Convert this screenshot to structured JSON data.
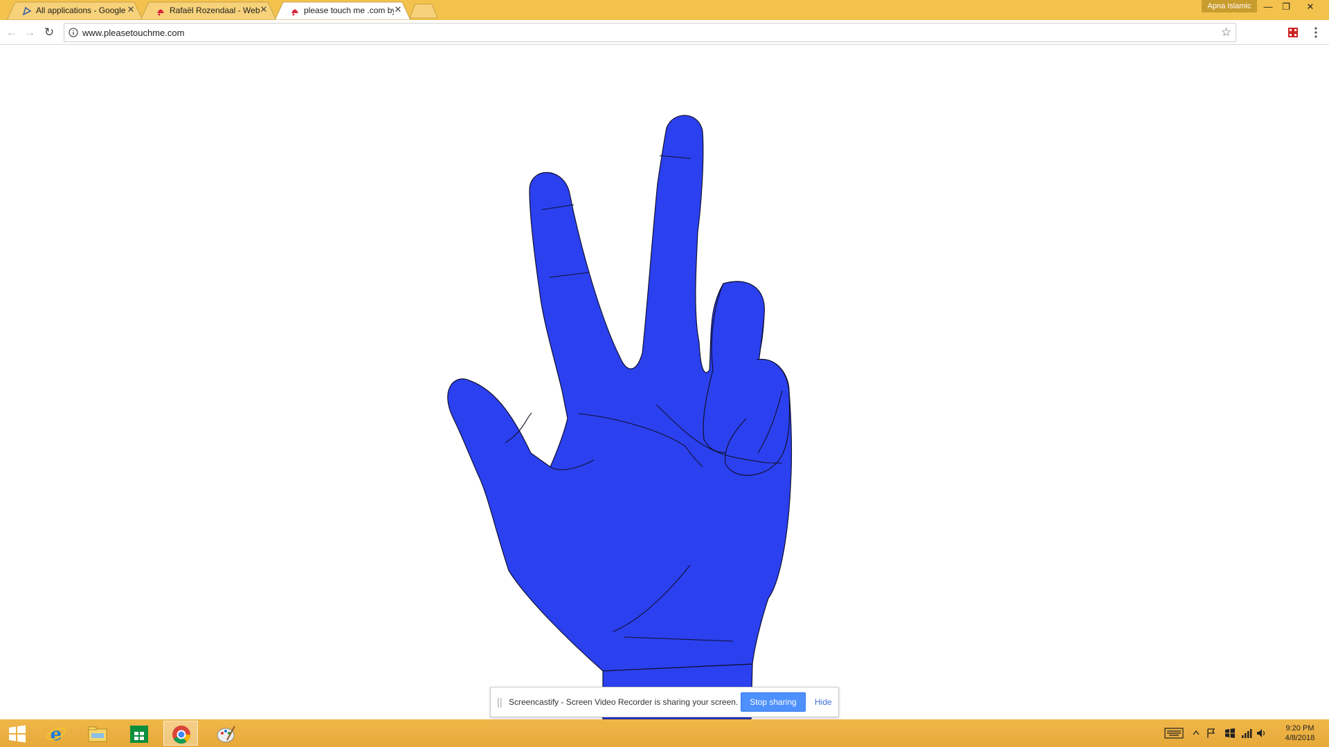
{
  "browser": {
    "tabs": [
      {
        "title": "All applications - Google",
        "favicon": "google-drive-like-icon",
        "active": false
      },
      {
        "title": "Rafaël Rozendaal - Webs",
        "favicon": "rafael-rozendaal-icon",
        "active": false
      },
      {
        "title": "please touch me .com by",
        "favicon": "rafael-rozendaal-icon",
        "active": true
      }
    ],
    "profile_name": "Apna Islamic",
    "url": "www.pleasetouchme.com",
    "icons": {
      "back": "back-arrow-icon",
      "forward": "forward-arrow-icon",
      "reload": "reload-icon",
      "info": "info-icon",
      "bookmark": "star-icon",
      "extension": "screencastify-icon",
      "menu": "kebab-menu-icon"
    }
  },
  "page": {
    "hand_color": "#2b41ef",
    "outline_color": "#101030"
  },
  "sharebar": {
    "message": "Screencastify - Screen Video Recorder is sharing your screen.",
    "stop_label": "Stop sharing",
    "hide_label": "Hide"
  },
  "taskbar": {
    "time": "9:20 PM",
    "date": "4/8/2018",
    "apps": [
      "start-icon",
      "internet-explorer-icon",
      "file-explorer-icon",
      "store-icon",
      "chrome-icon",
      "paint-icon"
    ]
  },
  "colors": {
    "titlebar": "#f3c24c",
    "taskbar": "#e9ad3d",
    "accent_button": "#4d90fe"
  }
}
